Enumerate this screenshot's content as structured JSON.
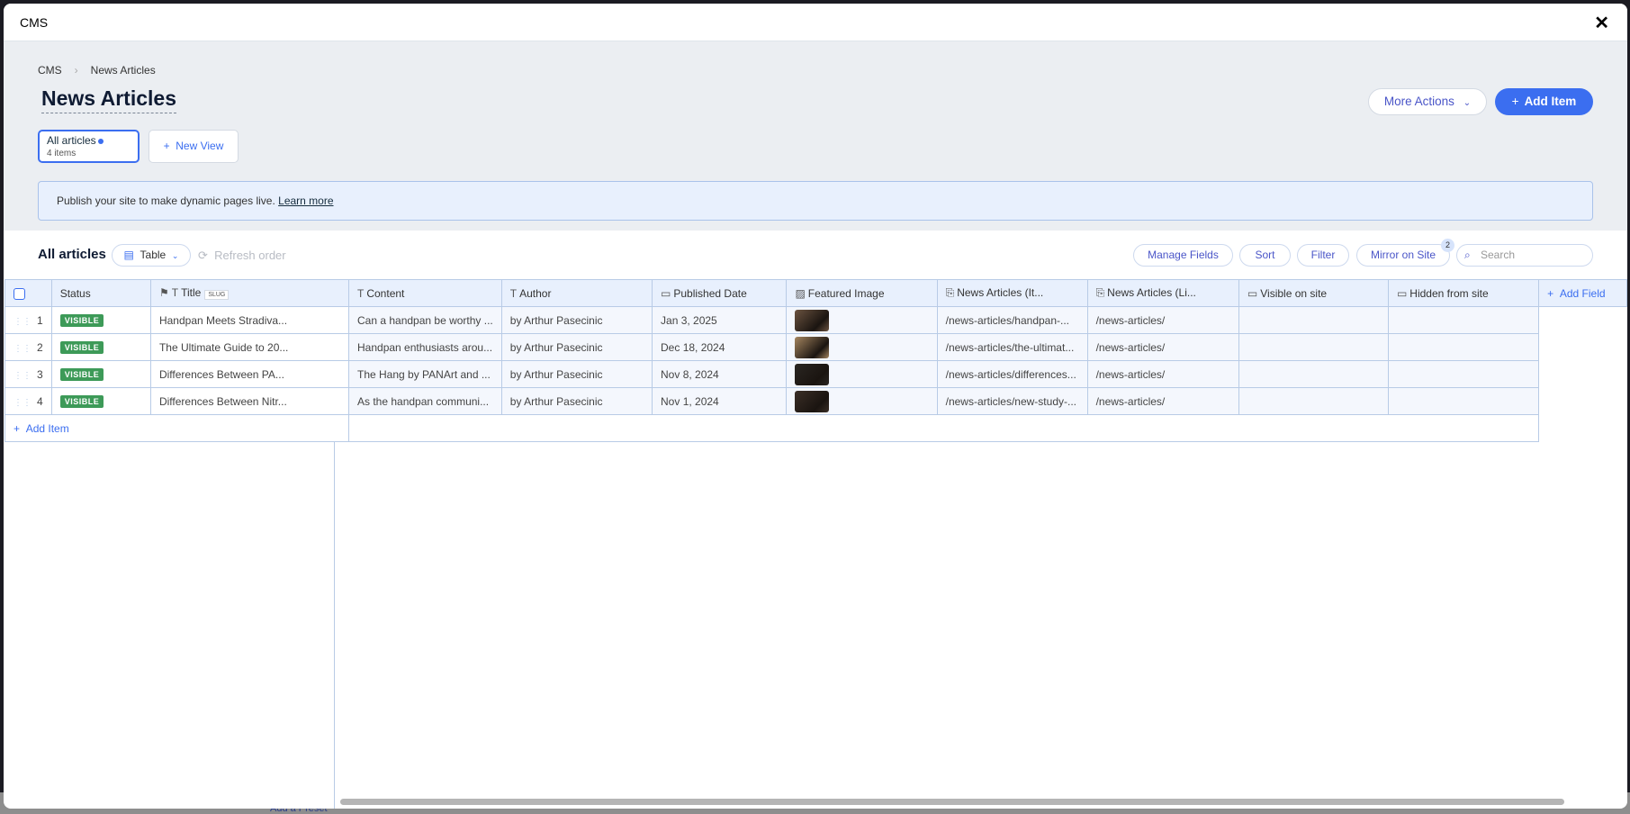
{
  "window": {
    "title": "CMS",
    "close_icon": "close-icon"
  },
  "breadcrumb": [
    "CMS",
    "News Articles"
  ],
  "page_title": "News Articles",
  "header_actions": {
    "more_actions": "More Actions",
    "add_item": "Add Item"
  },
  "views": {
    "active": {
      "name": "All articles",
      "count": "4 items"
    },
    "new_view": "New View"
  },
  "banner": {
    "text": "Publish your site to make dynamic pages live.",
    "link": "Learn more"
  },
  "toolbar": {
    "title": "All articles",
    "layout": "Table",
    "refresh": "Refresh order",
    "manage_fields": "Manage Fields",
    "sort": "Sort",
    "filter": "Filter",
    "mirror": "Mirror on Site",
    "mirror_badge": "2",
    "search_placeholder": "Search"
  },
  "table": {
    "columns": [
      "Status",
      "Title",
      "Content",
      "Author",
      "Published Date",
      "Featured Image",
      "News Articles (It...",
      "News Articles (Li...",
      "Visible on site",
      "Hidden from site"
    ],
    "slug_tag": "SLUG",
    "add_field": "Add Field",
    "add_item": "Add Item",
    "rows": [
      {
        "num": "1",
        "status": "VISIBLE",
        "title": "Handpan Meets Stradiva...",
        "content": "Can a handpan be worthy ...",
        "author": "by Arthur Pasecinic",
        "date": "Jan 3, 2025",
        "image_color": "#6b5340",
        "item_url": "/news-articles/handpan-...",
        "list_url": "/news-articles/",
        "visible_on": "",
        "hidden_from": ""
      },
      {
        "num": "2",
        "status": "VISIBLE",
        "title": "The Ultimate Guide to 20...",
        "content": "Handpan enthusiasts arou...",
        "author": "by Arthur Pasecinic",
        "date": "Dec 18, 2024",
        "image_color": "#a58660",
        "item_url": "/news-articles/the-ultimat...",
        "list_url": "/news-articles/",
        "visible_on": "",
        "hidden_from": ""
      },
      {
        "num": "3",
        "status": "VISIBLE",
        "title": "Differences Between PA...",
        "content": "The Hang by PANArt and ...",
        "author": "by Arthur Pasecinic",
        "date": "Nov 8, 2024",
        "image_color": "#2a2622",
        "item_url": "/news-articles/differences...",
        "list_url": "/news-articles/",
        "visible_on": "",
        "hidden_from": ""
      },
      {
        "num": "4",
        "status": "VISIBLE",
        "title": "Differences Between Nitr...",
        "content": "As the handpan communi...",
        "author": "by Arthur Pasecinic",
        "date": "Nov 1, 2024",
        "image_color": "#3a2e26",
        "item_url": "/news-articles/new-study-...",
        "list_url": "/news-articles/",
        "visible_on": "",
        "hidden_from": ""
      }
    ]
  },
  "background": {
    "add_preset": "Add a Preset"
  }
}
